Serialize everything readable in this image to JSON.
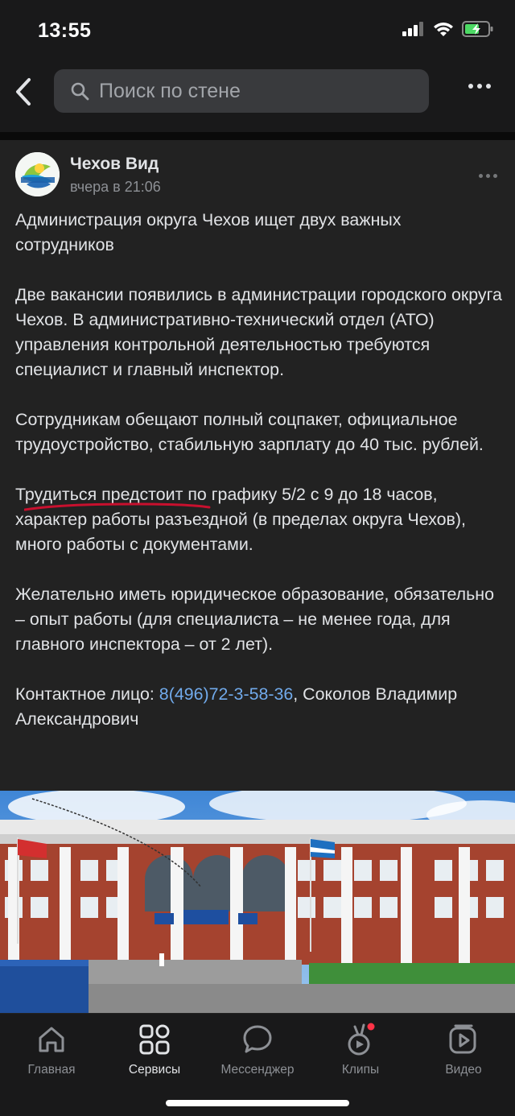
{
  "status_bar": {
    "time": "13:55"
  },
  "top_bar": {
    "search_placeholder": "Поиск по стене"
  },
  "post": {
    "author": "Чехов Вид",
    "time": "вчера в 21:06",
    "paragraphs": [
      "Администрация округа Чехов ищет двух важных сотрудников",
      "Две вакансии появились в администрации городского округа Чехов. В административно-технический отдел (АТО) управления контрольной деятельностью требуются специалист и главный инспектор.",
      "Сотрудникам обещают полный соцпакет, официальное трудоустройство, стабильную зарплату до 40 тыс. рублей.",
      "Трудиться предстоит по графику 5/2 с 9 до 18 часов, характер работы разъездной (в пределах округа Чехов), много работы с документами.",
      "Желательно иметь юридическое образование, обязательно – опыт работы (для специалиста – не менее года, для главного инспектора – от 2 лет)."
    ],
    "contact_prefix": "Контактное лицо: ",
    "contact_phone": "8(496)72-3-58-36",
    "contact_suffix": ", Соколов Владимир Александрович"
  },
  "tabs": [
    {
      "label": "Главная",
      "icon": "home-icon",
      "active": false
    },
    {
      "label": "Сервисы",
      "icon": "services-icon",
      "active": true
    },
    {
      "label": "Мессенджер",
      "icon": "messenger-icon",
      "active": false
    },
    {
      "label": "Клипы",
      "icon": "clips-icon",
      "active": false,
      "badge": true
    },
    {
      "label": "Видео",
      "icon": "video-icon",
      "active": false
    }
  ],
  "colors": {
    "background": "#19191a",
    "post_bg": "#222222",
    "link": "#71aaeb",
    "underline_mark": "#c8102e",
    "badge": "#ff3347"
  }
}
